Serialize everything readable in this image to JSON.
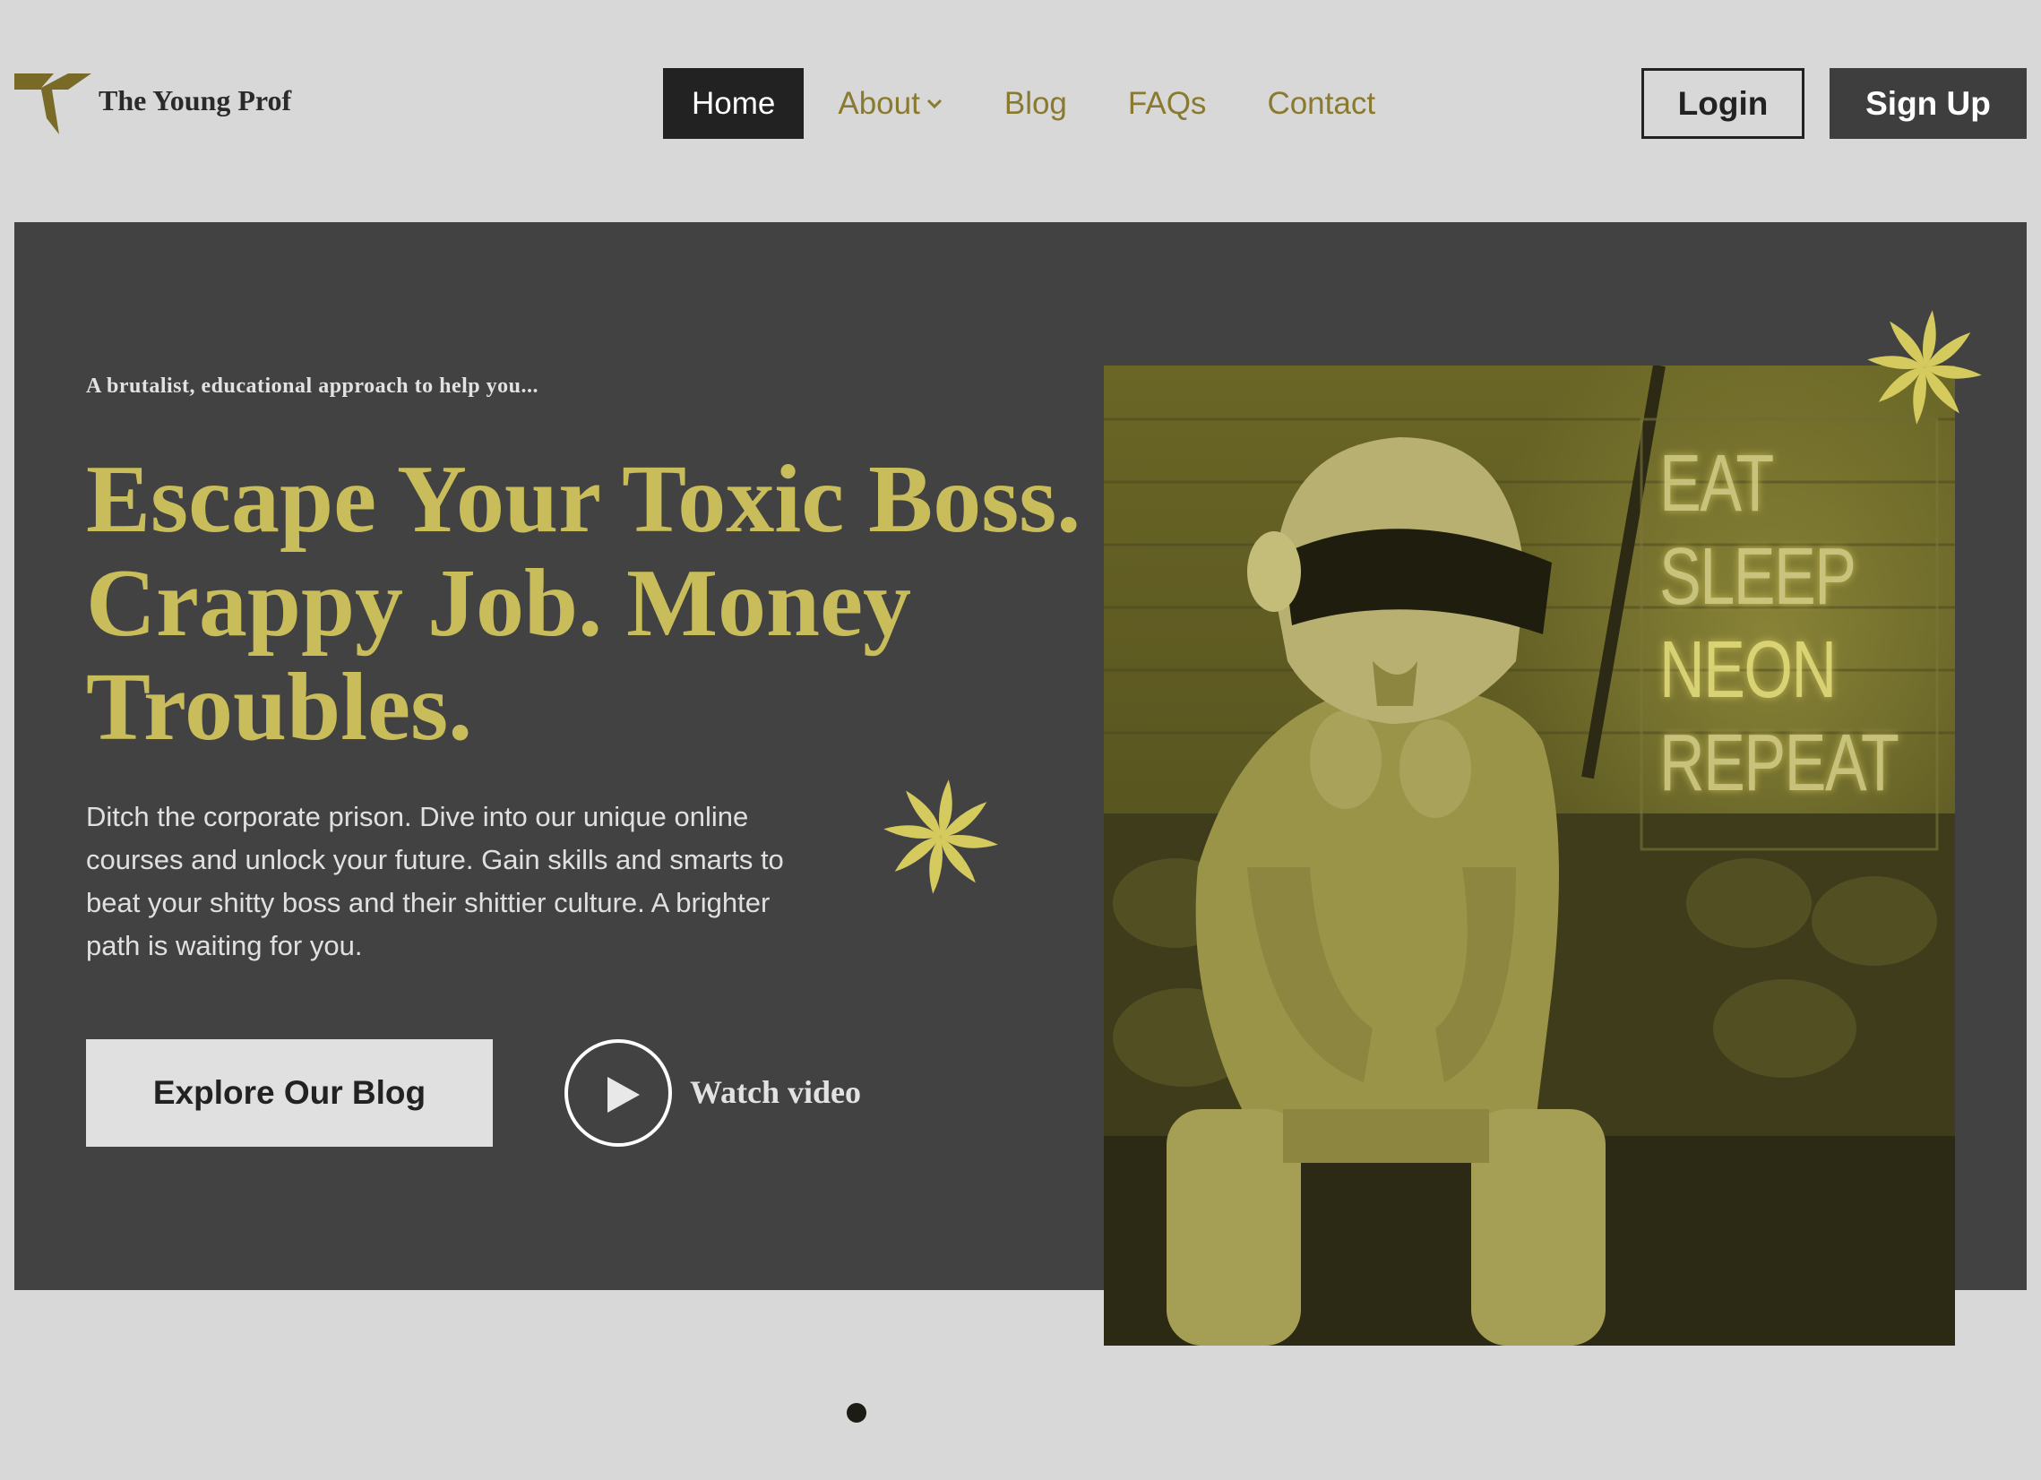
{
  "brand": {
    "name": "The Young Prof",
    "logo_icon": "t-chevron-logo",
    "accent": "#8a7a30"
  },
  "nav": {
    "items": [
      {
        "label": "Home",
        "active": true
      },
      {
        "label": "About",
        "dropdown": true
      },
      {
        "label": "Blog"
      },
      {
        "label": "FAQs"
      },
      {
        "label": "Contact"
      }
    ]
  },
  "auth": {
    "login_label": "Login",
    "signup_label": "Sign Up"
  },
  "hero": {
    "eyebrow": "A brutalist, educational approach to help you...",
    "headline": [
      "Escape Your Toxic Boss.",
      "Crappy Job. Money",
      "Troubles."
    ],
    "description": "Ditch the corporate prison. Dive into our unique online courses and unlock your future. Gain skills and smarts to beat your shitty boss and their shittier culture. A brighter path is waiting for you.",
    "cta_label": "Explore Our Blog",
    "video_label": "Watch video",
    "image": {
      "subject": "person in chrome helmet sitting on leather couch",
      "neon_sign": [
        "EAT",
        "SLEEP",
        "NEON",
        "REPEAT"
      ]
    },
    "colors": {
      "panel": "#424242",
      "headline": "#c8bd5a",
      "star": "#d4ca5e"
    }
  },
  "carousel": {
    "active_index": 0,
    "count": 1
  }
}
